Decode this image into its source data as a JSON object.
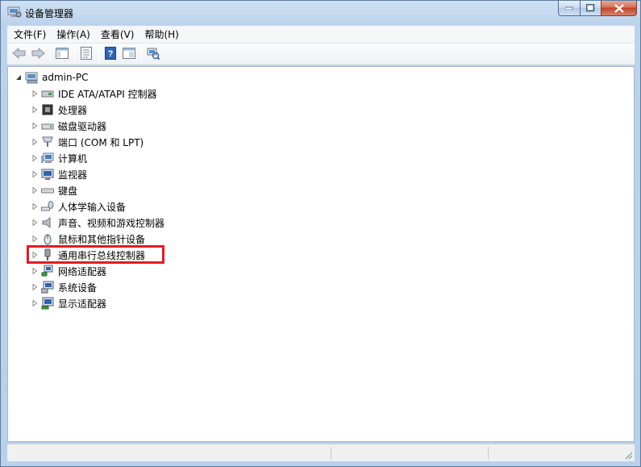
{
  "window": {
    "title": "设备管理器"
  },
  "menu": [
    {
      "label": "文件(F)"
    },
    {
      "label": "操作(A)"
    },
    {
      "label": "查看(V)"
    },
    {
      "label": "帮助(H)"
    }
  ],
  "toolbar": {
    "icons": [
      "back-icon",
      "forward-icon",
      "show-hide-console-tree-icon",
      "properties-icon",
      "help-icon",
      "view-icon",
      "scan-hardware-icon"
    ]
  },
  "tree": {
    "root": {
      "label": "admin-PC",
      "icon": "computer-icon",
      "expanded": true
    },
    "children": [
      {
        "label": "IDE ATA/ATAPI 控制器",
        "icon": "ide-controller-icon"
      },
      {
        "label": "处理器",
        "icon": "processor-icon"
      },
      {
        "label": "磁盘驱动器",
        "icon": "disk-drive-icon"
      },
      {
        "label": "端口 (COM 和 LPT)",
        "icon": "port-icon"
      },
      {
        "label": "计算机",
        "icon": "computer-icon"
      },
      {
        "label": "监视器",
        "icon": "monitor-icon"
      },
      {
        "label": "键盘",
        "icon": "keyboard-icon"
      },
      {
        "label": "人体学输入设备",
        "icon": "hid-icon"
      },
      {
        "label": "声音、视频和游戏控制器",
        "icon": "sound-icon"
      },
      {
        "label": "鼠标和其他指针设备",
        "icon": "mouse-icon"
      },
      {
        "label": "通用串行总线控制器",
        "icon": "usb-icon",
        "highlighted": true
      },
      {
        "label": "网络适配器",
        "icon": "network-adapter-icon"
      },
      {
        "label": "系统设备",
        "icon": "system-device-icon"
      },
      {
        "label": "显示适配器",
        "icon": "display-adapter-icon"
      }
    ]
  },
  "colors": {
    "highlight_border": "#e11b22",
    "title_bg": "#bcd3ec"
  }
}
